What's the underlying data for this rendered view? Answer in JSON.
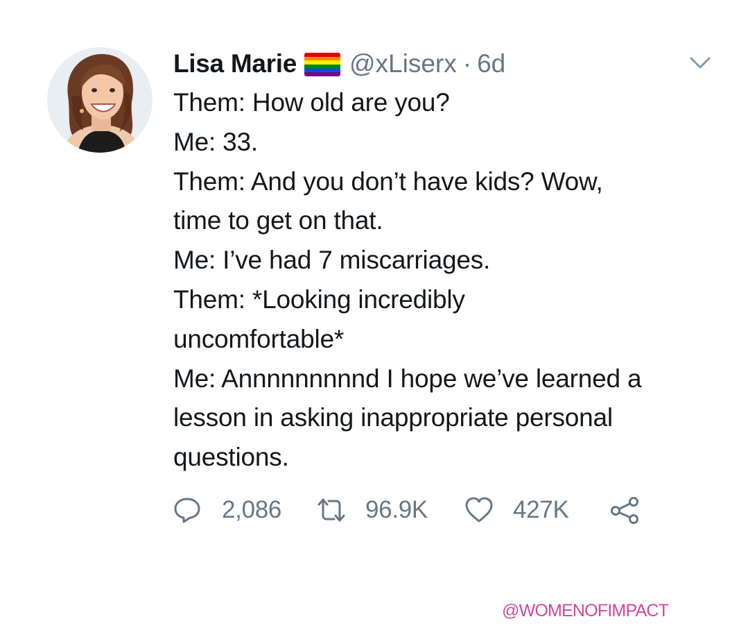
{
  "tweet": {
    "author": {
      "display_name": "Lisa Marie",
      "handle": "@xLiserx",
      "flag_icon": "rainbow-flag-icon"
    },
    "separator": "·",
    "timestamp": "6d",
    "lines": [
      "Them: How old are you?",
      "Me: 33.",
      "Them: And you don’t have kids? Wow,",
      "time to get on that.",
      "Me: I’ve had 7 miscarriages.",
      "Them: *Looking incredibly",
      "uncomfortable*",
      "Me: Annnnnnnnnd I hope we’ve learned a",
      "lesson in asking inappropriate personal",
      "questions."
    ],
    "stats": {
      "replies": "2,086",
      "retweets": "96.9K",
      "likes": "427K"
    }
  },
  "watermark": "@WOMENOFIMPACT",
  "colors": {
    "text": "#14171a",
    "muted": "#657786",
    "watermark": "#d2479b",
    "flag": [
      "#e40303",
      "#ff8c00",
      "#ffed00",
      "#008026",
      "#004dff",
      "#750787"
    ]
  }
}
